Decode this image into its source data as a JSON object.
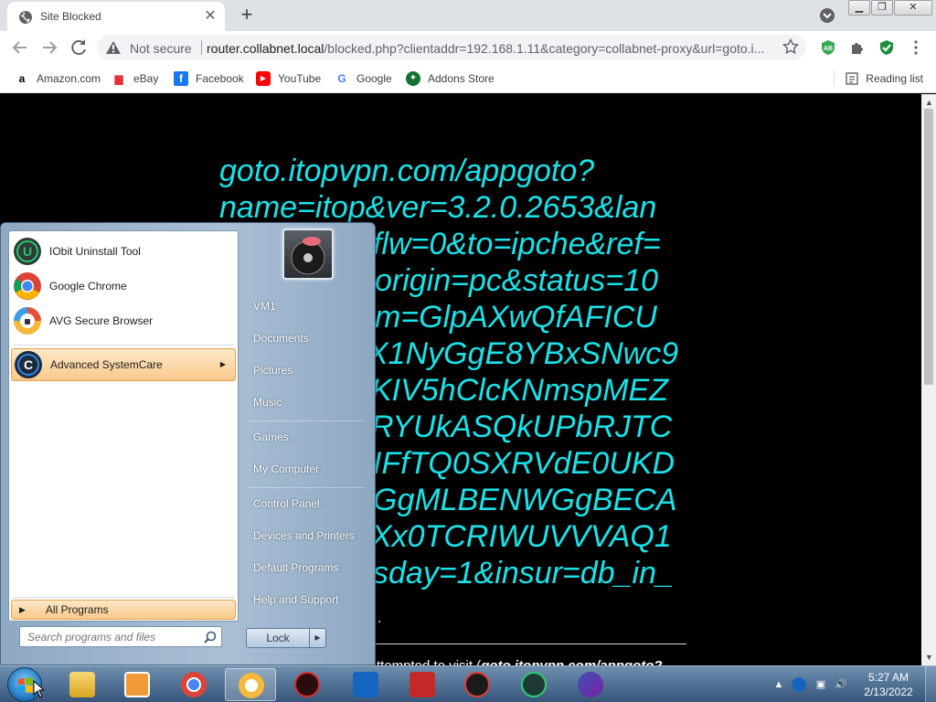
{
  "browser": {
    "tab_title": "Site Blocked",
    "tab_close": "✕",
    "new_tab": "+",
    "window_controls": {
      "minimize": "▁",
      "maximize": "❐",
      "close": "✕"
    },
    "security_label": "Not secure",
    "url_host": "router.collabnet.local",
    "url_rest": "/blocked.php?clientaddr=192.168.1.11&category=collabnet-proxy&url=goto.i...",
    "extensions": [
      "adblock-icon",
      "puzzle-extensions-icon",
      "shield-check-icon",
      "more-vert-icon"
    ]
  },
  "bookmarks": [
    {
      "label": "Amazon.com",
      "icon": "amazon-icon",
      "glyph": "a",
      "color": "#000000"
    },
    {
      "label": "eBay",
      "icon": "ebay-icon",
      "glyph": "▆",
      "color": "#e53238"
    },
    {
      "label": "Facebook",
      "icon": "facebook-icon",
      "glyph": "f",
      "color": "#1877f2"
    },
    {
      "label": "YouTube",
      "icon": "youtube-icon",
      "glyph": "▶",
      "color": "#ff0000"
    },
    {
      "label": "Google",
      "icon": "google-icon",
      "glyph": "G",
      "color": "#4285f4"
    },
    {
      "label": "Addons Store",
      "icon": "addons-store-icon",
      "glyph": "✦",
      "color": "#137333"
    }
  ],
  "reading_list": "Reading list",
  "page": {
    "blocked_url": "goto.itopvpn.com/appgoto?name=itop&ver=3.2.0.2653&lan",
    "blocked_url_lines": [
      "goto.itopvpn.com/appgoto?",
      "name=itop&ver=3.2.0.2653&lan",
      "flw=0&to=ipche&ref=",
      "origin=pc&status=10",
      "m=GlpAXwQfAFICU",
      "X1NyGgE8YBxSNwc9",
      "KIV5hClcKNmspMEZ",
      "RYUkASQkUPbRJTC",
      "IFfTQ0SXRVdE0UKD",
      "GgMLBENWGgBECA",
      "Xx0TCRIWUVVVAQ1",
      "sday=1&insur=db_in_"
    ],
    "attempt_prefix": "ttempted to visit (",
    "attempt_url": "goto.itopvpn.com/appgoto?",
    "dot": "."
  },
  "start_menu": {
    "programs": [
      {
        "label": "IObit Uninstall Tool",
        "color": "#1f8a5a",
        "glyph": "U"
      },
      {
        "label": "Google Chrome",
        "color": "#4285f4",
        "glyph": ""
      },
      {
        "label": "AVG Secure Browser",
        "color": "#e8a33d",
        "glyph": ""
      },
      {
        "label": "Advanced SystemCare",
        "color": "#1a5fb4",
        "glyph": "C",
        "submenu": "▶"
      }
    ],
    "all_programs": "All Programs",
    "search_placeholder": "Search programs and files",
    "right_links": [
      "VM1",
      "Documents",
      "Pictures",
      "Music",
      "Games",
      "My Computer",
      "Control Panel",
      "Devices and Printers",
      "Default Programs",
      "Help and Support"
    ],
    "lock_label": "Lock",
    "lock_arrow": "▶"
  },
  "taskbar": {
    "pinned": [
      "file-explorer-icon",
      "media-player-icon",
      "chrome-icon",
      "avg-browser-icon",
      "iobit-malware-fighter-icon",
      "shield-vpn-icon",
      "screen-recorder-icon",
      "driver-booster-icon",
      "itop-vpn-icon",
      "advanced-systemcare-icon"
    ],
    "time": "5:27 AM",
    "date": "2/13/2022",
    "tray_expand": "▲"
  }
}
